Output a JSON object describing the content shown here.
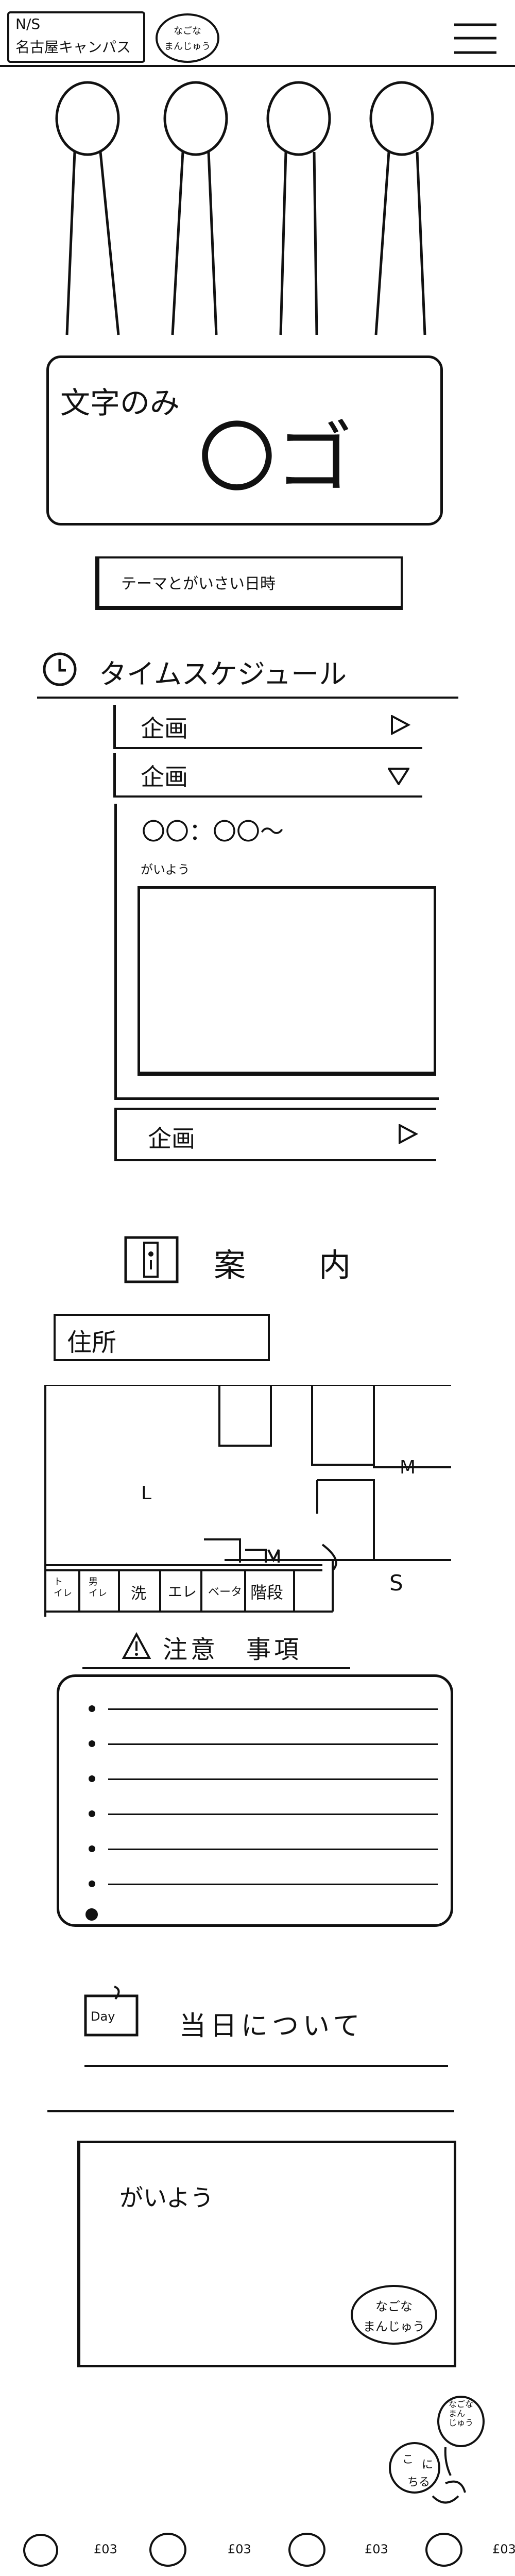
{
  "header": {
    "logo_line1": "N/S",
    "logo_line2": "名古屋キャンパス",
    "badge_line1": "なごな",
    "badge_line2": "まんじゅう",
    "menu_icon": "hamburger-menu-icon"
  },
  "hero": {
    "title_left": "文字のみ",
    "title_right": "〇ゴ",
    "theme_label": "テーマとがいさい日時"
  },
  "schedule": {
    "icon": "clock-icon",
    "title": "タイムスケジュール",
    "items": [
      {
        "label": "企画",
        "icon": "triangle-right-icon"
      },
      {
        "label": "企画",
        "icon": "triangle-down-icon"
      }
    ],
    "time": "〇〇：〇〇～",
    "overview_label": "がいよう",
    "last_item": {
      "label": "企画",
      "icon": "triangle-right-icon"
    }
  },
  "guide": {
    "title": "案　内",
    "icon": "guide-board-icon",
    "address_label": "住所",
    "map_labels": {
      "l": "L",
      "m": "M",
      "s": "S"
    },
    "map_bottom": [
      "ト\nイレ",
      "男\nイレ",
      "洗",
      "エレ",
      "ベータ",
      "階段"
    ]
  },
  "notes": {
    "icon": "warning-icon",
    "title": "注意　事項",
    "bullets": 7
  },
  "day": {
    "icon_label": "Day",
    "title": "当日について",
    "overview_label": "がいよう",
    "badge_line1": "なごな",
    "badge_line2": "まんじゅう"
  },
  "mascot": {
    "speech": "なごな\nまん\nじゅう",
    "text_line1": "こ",
    "text_line2": "に",
    "text_line3": "ちる"
  },
  "footer": {
    "items": [
      "£03",
      "£03",
      "£03",
      "£03"
    ]
  }
}
